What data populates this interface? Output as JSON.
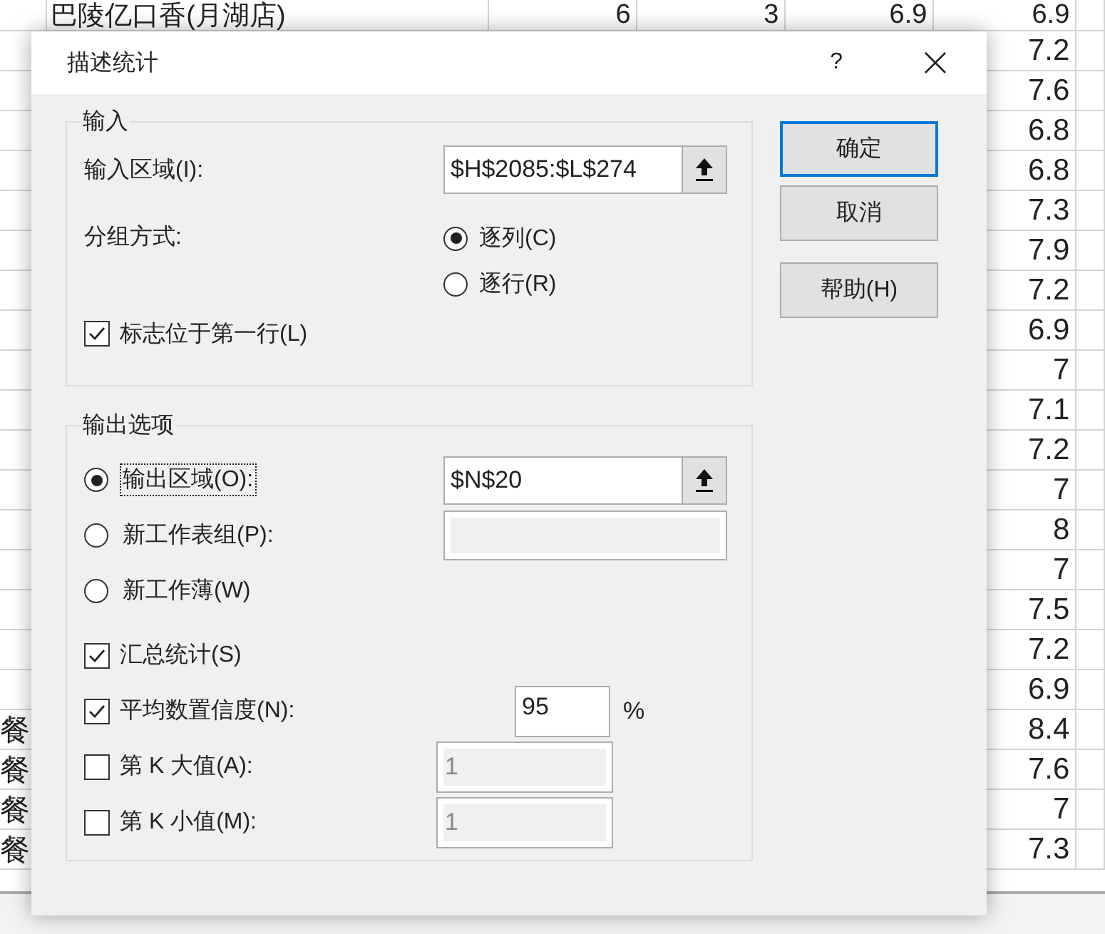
{
  "spreadsheet": {
    "rows": [
      {
        "column_2": "巴陵亿口香(月湖店)",
        "column_3": "6",
        "column_4": "3",
        "column_5": "6.9",
        "column_6": "6.9"
      },
      {
        "column_6": "7.2"
      },
      {
        "column_6": "7.6"
      },
      {
        "column_6": "6.8"
      },
      {
        "column_6": "6.8"
      },
      {
        "column_6": "7.3"
      },
      {
        "column_6": "7.9"
      },
      {
        "column_6": "7.2"
      },
      {
        "column_6": "6.9"
      },
      {
        "column_6": "7"
      },
      {
        "column_6": "7.1"
      },
      {
        "column_6": "7.2"
      },
      {
        "column_6": "7"
      },
      {
        "column_6": "8"
      },
      {
        "column_6": "7"
      },
      {
        "column_6": "7.5"
      },
      {
        "column_6": "7.2"
      },
      {
        "column_6": "6.9"
      },
      {
        "column_1": "餐",
        "column_6": "8.4"
      },
      {
        "column_1": "餐",
        "column_6": "7.6"
      },
      {
        "column_1": "餐",
        "column_6": "7"
      },
      {
        "column_1": "餐",
        "column_6": "7.3"
      }
    ]
  },
  "dialog": {
    "title": "描述统计",
    "help_button": "?",
    "input_group": {
      "legend": "输入",
      "input_range": {
        "label": "输入区域(I):",
        "value": "$H$2085:$L$274"
      },
      "grouping": {
        "label": "分组方式:",
        "options": [
          {
            "label": "逐列(C)",
            "selected": true
          },
          {
            "label": "逐行(R)",
            "selected": false
          }
        ]
      },
      "labels_in_first_row": {
        "label": "标志位于第一行(L)",
        "checked": true
      }
    },
    "output_group": {
      "legend": "输出选项",
      "destinations": [
        {
          "kind": "range",
          "label": "输出区域(O):",
          "selected": true,
          "value": "$N$20"
        },
        {
          "kind": "text",
          "label": "新工作表组(P):",
          "selected": false
        },
        {
          "kind": "none",
          "label": "新工作薄(W)",
          "selected": false
        }
      ],
      "options": [
        {
          "kind": "plain",
          "label": "汇总统计(S)",
          "checked": true
        },
        {
          "kind": "percent",
          "label": "平均数置信度(N):",
          "checked": true,
          "value": "95",
          "unit": "%"
        },
        {
          "kind": "number",
          "label": "第 K 大值(A):",
          "checked": false,
          "value": "1"
        },
        {
          "kind": "number",
          "label": "第 K 小值(M):",
          "checked": false,
          "value": "1"
        }
      ]
    },
    "buttons": [
      {
        "label": "确定",
        "default": true
      },
      {
        "label": "取消",
        "default": false
      },
      {
        "label": "帮助(H)",
        "default": false
      }
    ]
  }
}
